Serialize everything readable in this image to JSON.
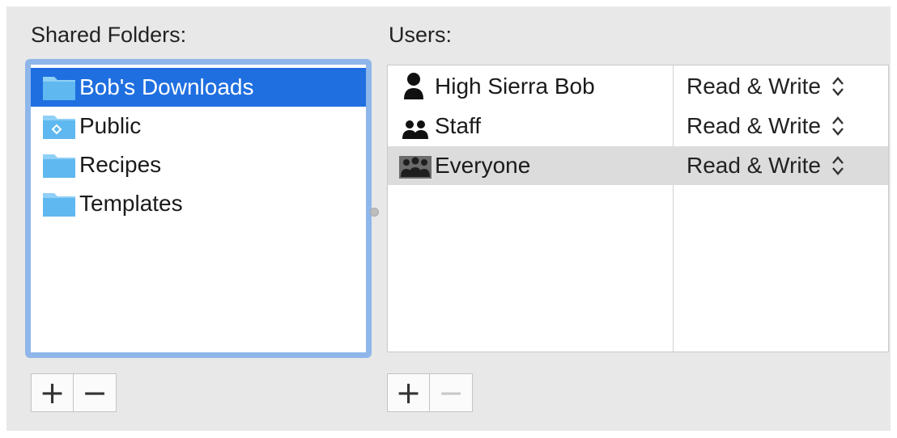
{
  "shared_folders": {
    "label": "Shared Folders:",
    "items": [
      {
        "name": "Bob's Downloads",
        "selected": true,
        "icon": "folder-icon"
      },
      {
        "name": "Public",
        "selected": false,
        "icon": "public-folder-icon"
      },
      {
        "name": "Recipes",
        "selected": false,
        "icon": "folder-icon"
      },
      {
        "name": "Templates",
        "selected": false,
        "icon": "folder-icon"
      }
    ],
    "add_label": "+",
    "remove_label": "−"
  },
  "users": {
    "label": "Users:",
    "rows": [
      {
        "name": "High Sierra Bob",
        "permission": "Read & Write",
        "icon": "single-user-icon",
        "highlighted": false
      },
      {
        "name": "Staff",
        "permission": "Read & Write",
        "icon": "group-icon",
        "highlighted": false
      },
      {
        "name": "Everyone",
        "permission": "Read & Write",
        "icon": "everyone-group-icon",
        "highlighted": true
      }
    ],
    "add_label": "+",
    "remove_label": "−",
    "remove_enabled": false
  },
  "colors": {
    "selection": "#1f6fe0",
    "focus_ring": "#8fb6ea",
    "folder": "#5fb8ef",
    "row_highlight": "#dcdcdc"
  }
}
